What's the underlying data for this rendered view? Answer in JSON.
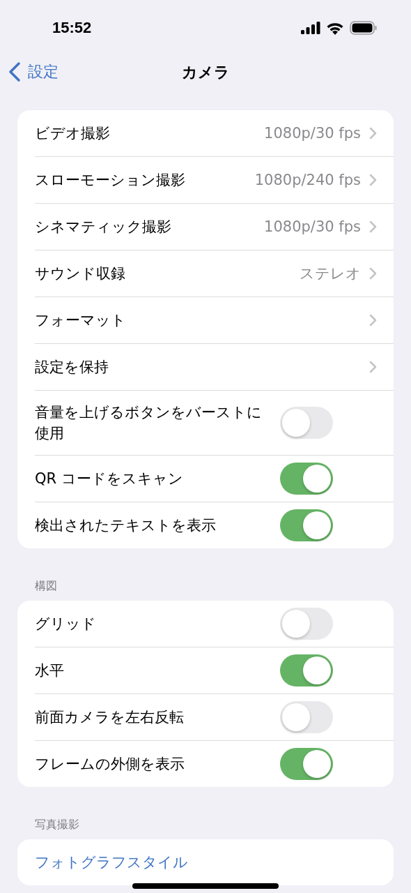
{
  "status_bar": {
    "time": "15:52"
  },
  "nav": {
    "back": "設定",
    "title": "カメラ"
  },
  "sections": [
    {
      "rows": [
        {
          "kind": "link",
          "label": "ビデオ撮影",
          "value": "1080p/30 fps"
        },
        {
          "kind": "link",
          "label": "スローモーション撮影",
          "value": "1080p/240 fps"
        },
        {
          "kind": "link",
          "label": "シネマティック撮影",
          "value": "1080p/30 fps"
        },
        {
          "kind": "link",
          "label": "サウンド収録",
          "value": "ステレオ"
        },
        {
          "kind": "link",
          "label": "フォーマット"
        },
        {
          "kind": "link",
          "label": "設定を保持"
        },
        {
          "kind": "toggle",
          "label": "音量を上げるボタンをバーストに使用",
          "on": false
        },
        {
          "kind": "toggle",
          "label": "QR コードをスキャン",
          "on": true
        },
        {
          "kind": "toggle",
          "label": "検出されたテキストを表示",
          "on": true
        }
      ]
    },
    {
      "header": "構図",
      "rows": [
        {
          "kind": "toggle",
          "label": "グリッド",
          "on": false
        },
        {
          "kind": "toggle",
          "label": "水平",
          "on": true
        },
        {
          "kind": "toggle",
          "label": "前面カメラを左右反転",
          "on": false
        },
        {
          "kind": "toggle",
          "label": "フレームの外側を表示",
          "on": true
        }
      ]
    },
    {
      "header": "写真撮影",
      "rows": [
        {
          "kind": "action",
          "label": "フォトグラフスタイル"
        }
      ]
    }
  ]
}
